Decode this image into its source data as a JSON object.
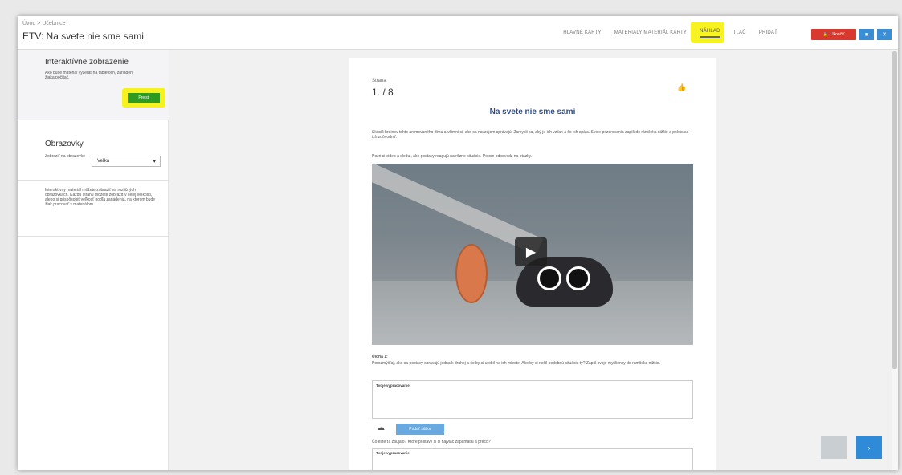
{
  "header": {
    "breadcrumb": "Úvod > Učebnice",
    "title": "ETV: Na svete nie sme sami",
    "tabs": [
      {
        "label": "Hlavné karty"
      },
      {
        "label": "Materiály materiál karty"
      },
      {
        "label": "Náhľad"
      },
      {
        "label": "Tlač"
      },
      {
        "label": "Pridať"
      }
    ],
    "red_button_label": "Ukončiť",
    "icon_buttons": [
      "■",
      "✕"
    ]
  },
  "sidebar": {
    "section1": {
      "title": "Interaktívne zobrazenie",
      "description": "Ako bude materiál vyzerať na tabletoch, zariadení žiaka počítač.",
      "button_label": "Prejsť"
    },
    "section2": {
      "title": "Obrazovky",
      "field_label": "Zobraziť na obrazovke",
      "select_value": "Veľká"
    },
    "section3": {
      "note": "Interaktívny materiál môžete zobraziť na rozličných obrazovkách. Každú stranu môžete zobraziť v celej veľkosti, alebo si prispôsobiť veľkosť podľa zariadenia, na ktorom bude žiak pracovať s materiálom."
    }
  },
  "page": {
    "label": "Strana",
    "number": "1. / 8",
    "title": "Na svete nie sme sami",
    "intro": "Skúsiš hrdinov tohto animovaného filmu a všimni si, ako sa navzájom správajú. Zamysli sa, aký je ich vzťah a čo ich spája. Svoje pozorovania zapíš do rámčeka nižšie a pokús sa ich zdôvodniť.",
    "video_caption": "Pozri si video a sleduj, ako postavy reagujú na rôzne situácie. Potom odpovedz na otázky.",
    "task_label": "Úloha 1:",
    "task_text": "Porozmýšľaj, ako sa postavy správajú jedna k druhej a čo by si urobil na ich mieste. Ako by si riešil podobnú situáciu ty? Zapíš svoje myšlienky do rámčeka nižšie.",
    "textarea_label": "Tvoje vypracovanie",
    "upload_label": "Pridať súbor",
    "followup": "Čo ešte ťa zaujalo? Ktoré postavy si si najviac zapamätal a prečo?",
    "textarea2_label": "Tvoje vypracovanie"
  }
}
